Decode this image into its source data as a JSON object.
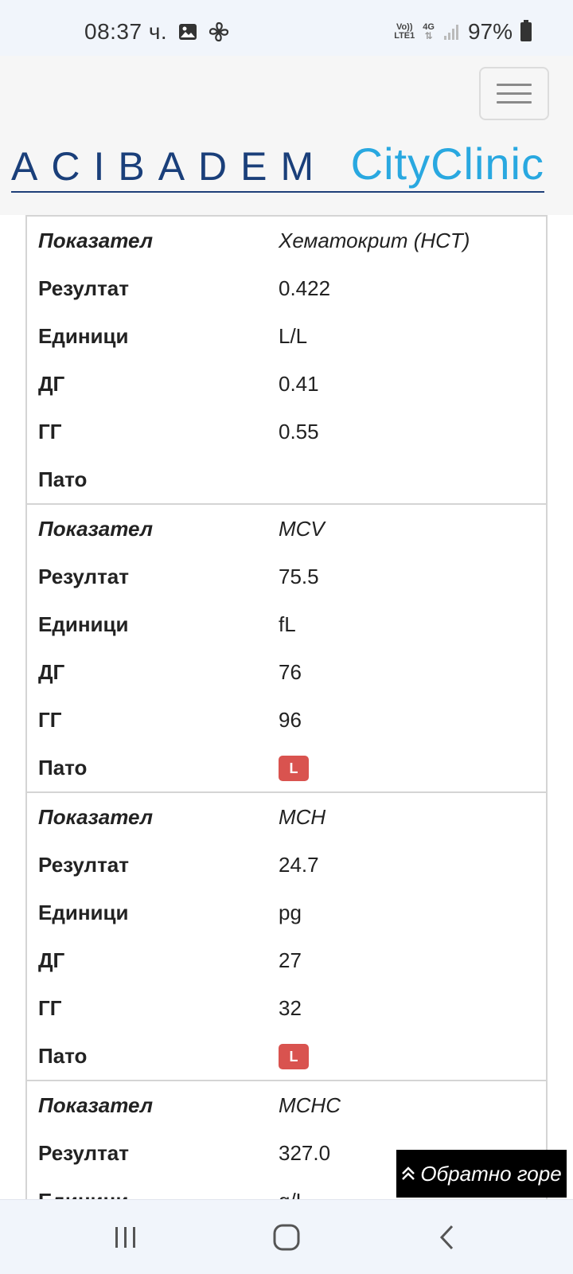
{
  "status_bar": {
    "time": "08:37 ч.",
    "volte_top": "Vo))",
    "volte_bottom": "LTE1",
    "network": "4G",
    "battery": "97%"
  },
  "header": {
    "logo_left": "ACIBADEM",
    "logo_right": "CityClinic"
  },
  "results": [
    {
      "name_label": "Показател",
      "name": "Хематокрит (HCT)",
      "result_label": "Резултат",
      "result": "0.422",
      "unit_label": "Единици",
      "unit": "L/L",
      "low_label": "ДГ",
      "low": "0.41",
      "high_label": "ГГ",
      "high": "0.55",
      "patho_label": "Пато",
      "patho": ""
    },
    {
      "name_label": "Показател",
      "name": "MCV",
      "result_label": "Резултат",
      "result": "75.5",
      "unit_label": "Единици",
      "unit": "fL",
      "low_label": "ДГ",
      "low": "76",
      "high_label": "ГГ",
      "high": "96",
      "patho_label": "Пато",
      "patho": "L"
    },
    {
      "name_label": "Показател",
      "name": "MCH",
      "result_label": "Резултат",
      "result": "24.7",
      "unit_label": "Единици",
      "unit": "pg",
      "low_label": "ДГ",
      "low": "27",
      "high_label": "ГГ",
      "high": "32",
      "patho_label": "Пато",
      "patho": "L"
    },
    {
      "name_label": "Показател",
      "name": "MCHC",
      "result_label": "Резултат",
      "result": "327.0",
      "unit_label": "Единици",
      "unit": "g/L"
    }
  ],
  "back_to_top": "Обратно горе",
  "colors": {
    "flag_low": "#d9534f",
    "logo_navy": "#1a3f7a",
    "logo_cyan": "#29a8e0"
  }
}
